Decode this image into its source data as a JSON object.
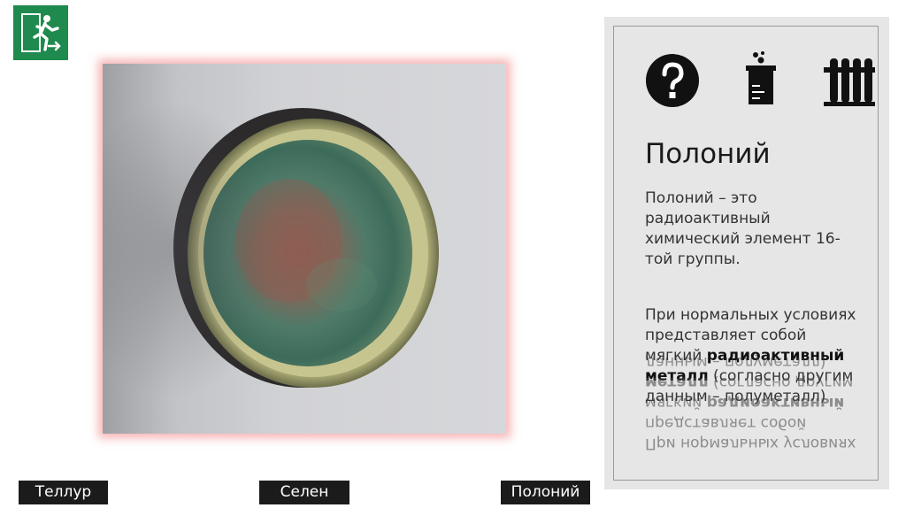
{
  "nav": {
    "exit_icon": "exit-door-icon",
    "buttons": [
      {
        "label": "Теллур"
      },
      {
        "label": "Селен"
      },
      {
        "label": "Полоний"
      }
    ]
  },
  "photo": {
    "subject": "polonium-sample-disc"
  },
  "panel": {
    "icons": [
      "question-icon",
      "beaker-icon",
      "test-tubes-icon"
    ],
    "title": "Полоний",
    "paragraph1": "Полоний – это радиоактивный химический элемент 16-той группы.",
    "paragraph2_before": "При нормальных условиях представляет собой мягкий ",
    "paragraph2_bold": "радиоактивный металл",
    "paragraph2_after": " (согласно другим данным – полуметалл)"
  },
  "colors": {
    "exit_green": "#1f8a4d",
    "nav_bg": "#1b1b1b",
    "panel_bg": "#e6e6e6",
    "photo_glow": "#f07878"
  }
}
